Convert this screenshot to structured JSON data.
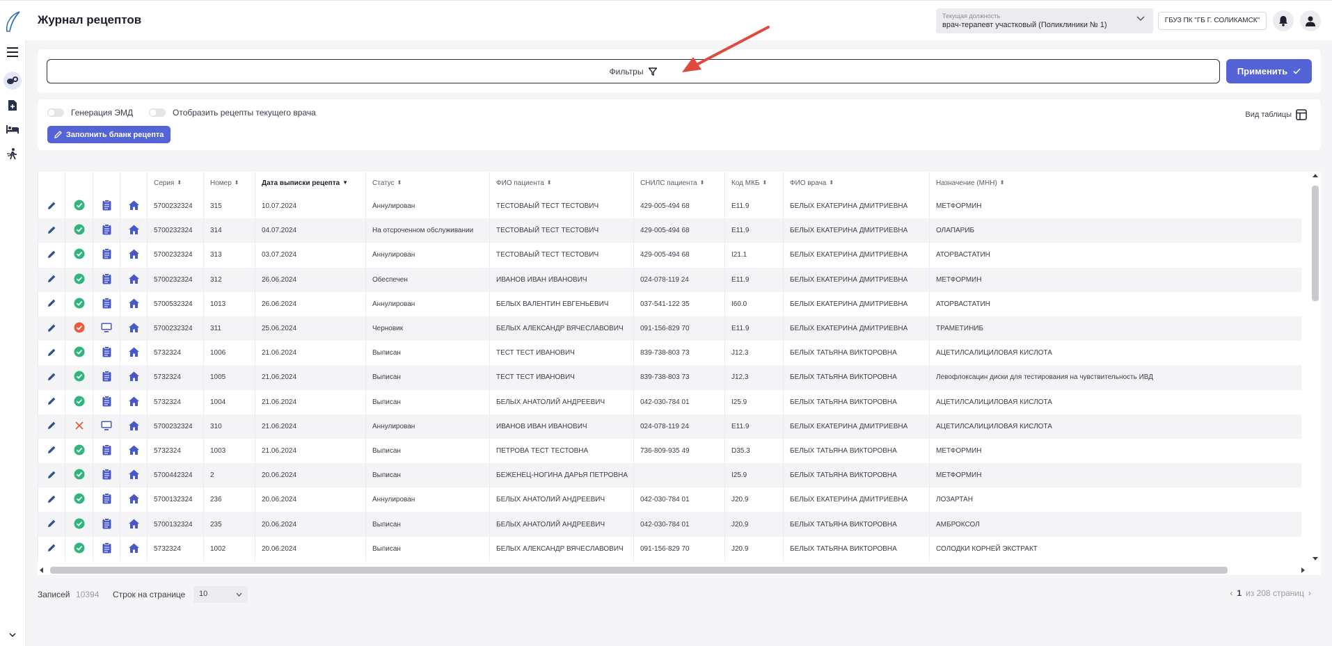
{
  "header": {
    "title": "Журнал рецептов",
    "position_label": "Текущая должность",
    "position_value": "врач-терапевт участковый (Поликлиники № 1)",
    "org": "ГБУЗ ПК \"ГБ Г. СОЛИКАМСК\""
  },
  "filters": {
    "label": "Фильтры",
    "apply_label": "Применить"
  },
  "options": {
    "toggle_emd": "Генерация ЭМД",
    "toggle_current_doctor": "Отобразить рецепты текущего врача",
    "fill_button": "Заполнить бланк рецепта",
    "view_label": "Вид таблицы"
  },
  "table": {
    "columns": [
      "Серия",
      "Номер",
      "Дата выписки рецепта",
      "Статус",
      "ФИО пациента",
      "СНИЛС пациента",
      "Код МКБ",
      "ФИО врача",
      "Назначение (МНН)"
    ],
    "rows": [
      {
        "status_icon": "ok",
        "doc_icon": "doc",
        "series": "5700232324",
        "number": "315",
        "date": "10.07.2024",
        "status": "Аннулирован",
        "patient": "ТЕСТОВАЫЙ ТЕСТ ТЕСТОВИЧ",
        "snils": "429-005-494 68",
        "mkb": "E11.9",
        "doctor": "БЕЛЫХ ЕКАТЕРИНА ДМИТРИЕВНА",
        "drug": "МЕТФОРМИН"
      },
      {
        "status_icon": "ok",
        "doc_icon": "doc",
        "series": "5700232324",
        "number": "314",
        "date": "04.07.2024",
        "status": "На отсроченном обслуживании",
        "patient": "ТЕСТОВАЫЙ ТЕСТ ТЕСТОВИЧ",
        "snils": "429-005-494 68",
        "mkb": "E11.9",
        "doctor": "БЕЛЫХ ЕКАТЕРИНА ДМИТРИЕВНА",
        "drug": "ОЛАПАРИБ"
      },
      {
        "status_icon": "ok",
        "doc_icon": "doc",
        "series": "5700232324",
        "number": "313",
        "date": "03.07.2024",
        "status": "Аннулирован",
        "patient": "ТЕСТОВАЫЙ ТЕСТ ТЕСТОВИЧ",
        "snils": "429-005-494 68",
        "mkb": "I21.1",
        "doctor": "БЕЛЫХ ЕКАТЕРИНА ДМИТРИЕВНА",
        "drug": "АТОРВАСТАТИН"
      },
      {
        "status_icon": "ok",
        "doc_icon": "doc",
        "series": "5700232324",
        "number": "312",
        "date": "26.06.2024",
        "status": "Обеспечен",
        "patient": "ИВАНОВ ИВАН ИВАНОВИЧ",
        "snils": "024-078-119 24",
        "mkb": "E11.9",
        "doctor": "БЕЛЫХ ЕКАТЕРИНА ДМИТРИЕВНА",
        "drug": "МЕТФОРМИН"
      },
      {
        "status_icon": "ok",
        "doc_icon": "doc",
        "series": "5700532324",
        "number": "1013",
        "date": "26.06.2024",
        "status": "Аннулирован",
        "patient": "БЕЛЫХ ВАЛЕНТИН ЕВГЕНЬЕВИЧ",
        "snils": "037-541-122 35",
        "mkb": "I60.0",
        "doctor": "БЕЛЫХ ЕКАТЕРИНА ДМИТРИЕВНА",
        "drug": "АТОРВАСТАТИН"
      },
      {
        "status_icon": "err",
        "doc_icon": "monitor",
        "series": "5700232324",
        "number": "311",
        "date": "25.06.2024",
        "status": "Черновик",
        "patient": "БЕЛЫХ АЛЕКСАНДР ВЯЧЕСЛАВОВИЧ",
        "snils": "091-156-829 70",
        "mkb": "E11.9",
        "doctor": "БЕЛЫХ ЕКАТЕРИНА ДМИТРИЕВНА",
        "drug": "ТРАМЕТИНИБ"
      },
      {
        "status_icon": "ok",
        "doc_icon": "doc",
        "series": "5732324",
        "number": "1006",
        "date": "21.06.2024",
        "status": "Выписан",
        "patient": "ТЕСТ ТЕСТ ИВАНОВИЧ",
        "snils": "839-738-803 73",
        "mkb": "J12.3",
        "doctor": "БЕЛЫХ ТАТЬЯНА ВИКТОРОВНА",
        "drug": "АЦЕТИЛСАЛИЦИЛОВАЯ КИСЛОТА"
      },
      {
        "status_icon": "ok",
        "doc_icon": "doc",
        "series": "5732324",
        "number": "1005",
        "date": "21.06.2024",
        "status": "Выписан",
        "patient": "ТЕСТ ТЕСТ ИВАНОВИЧ",
        "snils": "839-738-803 73",
        "mkb": "J12.3",
        "doctor": "БЕЛЫХ ТАТЬЯНА ВИКТОРОВНА",
        "drug": "Левофлоксацин диски для тестирования на чувствительность ИВД"
      },
      {
        "status_icon": "ok",
        "doc_icon": "doc",
        "series": "5732324",
        "number": "1004",
        "date": "21.06.2024",
        "status": "Выписан",
        "patient": "БЕЛЫХ АНАТОЛИЙ АНДРЕЕВИЧ",
        "snils": "042-030-784 01",
        "mkb": "I25.9",
        "doctor": "БЕЛЫХ ТАТЬЯНА ВИКТОРОВНА",
        "drug": "АЦЕТИЛСАЛИЦИЛОВАЯ КИСЛОТА"
      },
      {
        "status_icon": "x",
        "doc_icon": "monitor",
        "series": "5700232324",
        "number": "310",
        "date": "21.06.2024",
        "status": "Аннулирован",
        "patient": "ИВАНОВ ИВАН ИВАНОВИЧ",
        "snils": "024-078-119 24",
        "mkb": "E11.9",
        "doctor": "БЕЛЫХ ЕКАТЕРИНА ДМИТРИЕВНА",
        "drug": "АЦЕТИЛСАЛИЦИЛОВАЯ КИСЛОТА"
      },
      {
        "status_icon": "ok",
        "doc_icon": "doc",
        "series": "5732324",
        "number": "1003",
        "date": "21.06.2024",
        "status": "Выписан",
        "patient": "ПЕТРОВА ТЕСТ ТЕСТОВНА",
        "snils": "736-809-935 49",
        "mkb": "D35.3",
        "doctor": "БЕЛЫХ ТАТЬЯНА ВИКТОРОВНА",
        "drug": "МЕТФОРМИН"
      },
      {
        "status_icon": "ok",
        "doc_icon": "doc",
        "series": "5700442324",
        "number": "2",
        "date": "20.06.2024",
        "status": "Выписан",
        "patient": "БЕЖЕНЕЦ-НОГИНА ДАРЬЯ ПЕТРОВНА",
        "snils": "",
        "mkb": "I25.9",
        "doctor": "БЕЛЫХ ТАТЬЯНА ВИКТОРОВНА",
        "drug": "МЕТФОРМИН"
      },
      {
        "status_icon": "ok",
        "doc_icon": "doc",
        "series": "5700132324",
        "number": "236",
        "date": "20.06.2024",
        "status": "Аннулирован",
        "patient": "БЕЛЫХ АНАТОЛИЙ АНДРЕЕВИЧ",
        "snils": "042-030-784 01",
        "mkb": "J20.9",
        "doctor": "БЕЛЫХ ЕКАТЕРИНА ДМИТРИЕВНА",
        "drug": "ЛОЗАРТАН"
      },
      {
        "status_icon": "ok",
        "doc_icon": "doc",
        "series": "5700132324",
        "number": "235",
        "date": "20.06.2024",
        "status": "Выписан",
        "patient": "БЕЛЫХ АНАТОЛИЙ АНДРЕЕВИЧ",
        "snils": "042-030-784 01",
        "mkb": "J20.9",
        "doctor": "БЕЛЫХ ТАТЬЯНА ВИКТОРОВНА",
        "drug": "АМБРОКСОЛ"
      },
      {
        "status_icon": "ok",
        "doc_icon": "doc",
        "series": "5732324",
        "number": "1002",
        "date": "20.06.2024",
        "status": "Выписан",
        "patient": "БЕЛЫХ АЛЕКСАНДР ВЯЧЕСЛАВОВИЧ",
        "snils": "091-156-829 70",
        "mkb": "J20.9",
        "doctor": "БЕЛЫХ ТАТЬЯНА ВИКТОРОВНА",
        "drug": "СОЛОДКИ КОРНЕЙ ЭКСТРАКТ"
      }
    ]
  },
  "footer": {
    "records_label": "Записей",
    "records_count": "10394",
    "rows_per_page_label": "Строк на странице",
    "rows_per_page_value": "10",
    "current_page": "1",
    "pages_text": "из 208 страниц"
  },
  "colors": {
    "accent": "#5463d6",
    "ok": "#2fb67c",
    "error": "#ee5a3a",
    "annotation_arrow": "#e04a3b"
  }
}
